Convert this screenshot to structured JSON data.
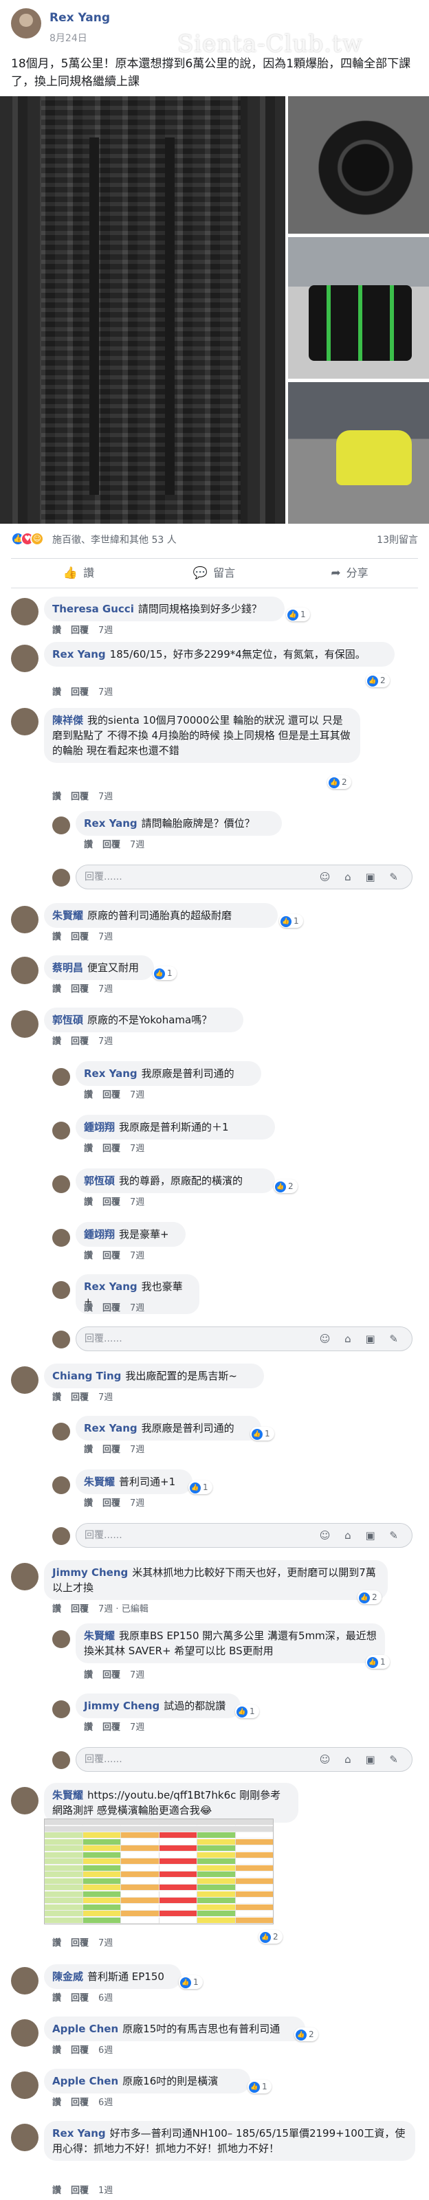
{
  "post": {
    "author": "Rex Yang",
    "date": "8月24日",
    "watermark": "Sienta-Club.tw",
    "text": "18個月，5萬公里！原本還想撐到6萬公里的說，因為1顆爆胎，四輪全部下課了，換上同規格繼續上課",
    "reactions_summary": "施百徹、李世緯和其他 53 人",
    "comment_count": "13則留言",
    "actions": {
      "like": "讚",
      "comment": "留言",
      "share": "分享"
    }
  },
  "comments": [
    {
      "name": "Theresa Gucci",
      "text": "請問同規格換到好多少錢？",
      "likes": "1",
      "time": "7週"
    },
    {
      "name": "Rex Yang",
      "text": "185/60/15，好市多2299*4無定位，有氮氣，有保固。",
      "likes": "2",
      "time": "7週"
    },
    {
      "name": "陳祥傑",
      "text": "我的sienta 10個月70000公里 輪胎的狀況 還可以 只是磨到點點了 不得不換 4月換胎的時候 換上同規格 但是是土耳其做的輪胎 現在看起來也還不錯",
      "likes": "2",
      "time": "7週",
      "replies": [
        {
          "name": "Rex Yang",
          "text": "請問輪胎廠牌是？價位？",
          "time": "7週"
        }
      ]
    },
    {
      "name": "朱賢耀",
      "text": "原廠的普利司通胎真的超級耐磨",
      "likes": "1",
      "time": "7週"
    },
    {
      "name": "蔡明昌",
      "text": "便宜又耐用",
      "likes": "1",
      "time": "7週"
    },
    {
      "name": "郭恆碩",
      "text": "原廠的不是Yokohama嗎？",
      "time": "7週",
      "replies": [
        {
          "name": "Rex Yang",
          "text": "我原廠是普利司通的",
          "time": "7週"
        },
        {
          "name": "鍾翊翔",
          "text": "我原廠是普利斯通的＋1",
          "time": "7週"
        },
        {
          "name": "郭恆碩",
          "text": "我的尊爵，原廠配的橫濱的",
          "likes": "2",
          "time": "7週"
        },
        {
          "name": "鍾翊翔",
          "text": "我是豪華+",
          "time": "7週"
        },
        {
          "name": "Rex Yang",
          "text": "我也豪華+",
          "time": "7週"
        }
      ]
    },
    {
      "name": "Chiang Ting",
      "text": "我出廠配置的是馬吉斯~",
      "time": "7週",
      "replies": [
        {
          "name": "Rex Yang",
          "text": "我原廠是普利司通的",
          "likes": "1",
          "time": "7週"
        },
        {
          "name": "朱賢耀",
          "text": "普利司通+1",
          "likes": "1",
          "time": "7週"
        }
      ]
    },
    {
      "name": "Jimmy Cheng",
      "text": "米其林抓地力比較好下雨天也好，更耐磨可以開到7萬以上才換",
      "likes": "2",
      "time": "7週 · 已編輯",
      "replies": [
        {
          "name": "朱賢耀",
          "text": "我原車BS EP150 開六萬多公里 溝還有5mm深，最近想換米其林 SAVER+ 希望可以比 BS更耐用",
          "likes": "1",
          "time": "7週"
        },
        {
          "name": "Jimmy Cheng",
          "text": "試過的都說讚",
          "likes": "1",
          "time": "7週"
        }
      ]
    },
    {
      "name": "朱賢耀",
      "text": "https://youtu.be/qff1Bt7hk6c 剛剛參考網路測評 感覺橫濱輪胎更適合我😂",
      "likes": "2",
      "time": "7週"
    },
    {
      "name": "陳金威",
      "text": "普利斯通 EP150",
      "likes": "1",
      "time": "6週"
    },
    {
      "name": "Apple Chen",
      "text": "原廠15吋的有馬吉思也有普利司通",
      "likes": "2",
      "time": "6週"
    },
    {
      "name": "Apple Chen",
      "text": "原廠16吋的則是橫濱",
      "likes": "1",
      "time": "6週"
    },
    {
      "name": "Rex Yang",
      "text": "好市多—普利司通NH100– 185/65/15單價2199+100工資，使用心得：抓地力不好！抓地力不好！抓地力不好！",
      "time": "1週"
    }
  ],
  "ui": {
    "reply_placeholder": "回覆......",
    "like_label": "讚",
    "reply_label": "回覆",
    "input_icons": "☺ ⌂ ▣ ✎"
  },
  "colors": {
    "name": "#385898",
    "meta": "#606770",
    "bubble": "#f2f3f5",
    "like_badge": "#1877f2"
  }
}
